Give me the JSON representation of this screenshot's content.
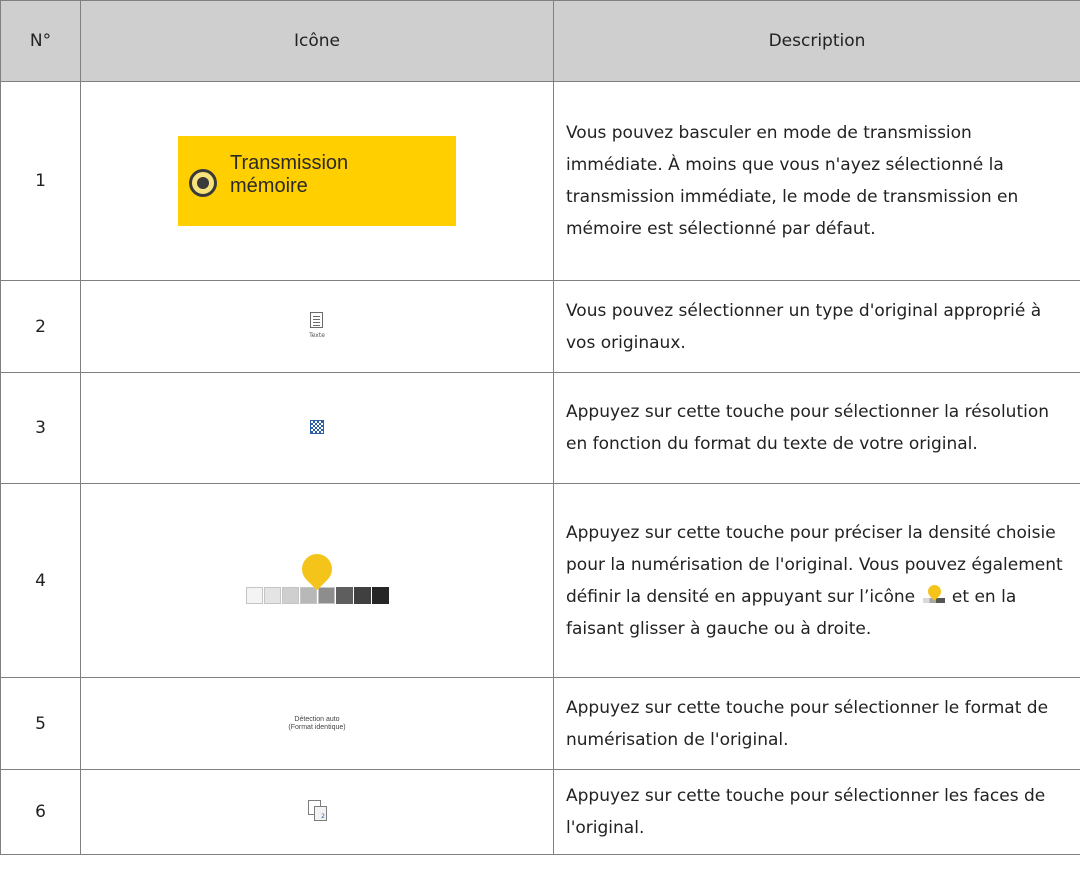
{
  "header": {
    "col_num": "N°",
    "col_icon": "Icône",
    "col_desc": "Description"
  },
  "rows": [
    {
      "num": "1",
      "icon_name": "memory-transmission-radio-icon",
      "icon_label_line1": "Transmission",
      "icon_label_line2": "mémoire",
      "desc": "Vous pouvez basculer en mode de transmission immédiate. À moins que vous n'ayez sélectionné la transmission immédiate, le mode de transmission en mémoire est sélectionné par défaut."
    },
    {
      "num": "2",
      "icon_name": "document-text-icon",
      "icon_caption": "Texte",
      "desc": "Vous pouvez sélectionner un type d'original approprié à vos originaux."
    },
    {
      "num": "3",
      "icon_name": "resolution-icon",
      "desc": "Appuyez sur cette touche pour sélectionner la résolution en fonction du format du texte de votre original."
    },
    {
      "num": "4",
      "icon_name": "density-slider-icon",
      "desc_part1": "Appuyez sur cette touche pour préciser la densité choisie pour la numérisation de l'original. Vous pouvez également définir la densité en appuyant sur l’icône ",
      "desc_part2": " et en la faisant glisser à gauche ou à droite."
    },
    {
      "num": "5",
      "icon_name": "auto-detect-size-icon",
      "icon_label_line1": "Détection auto",
      "icon_label_line2": "(Format identique)",
      "desc": "Appuyez sur cette touche pour sélectionner le format de numérisation de l'original."
    },
    {
      "num": "6",
      "icon_name": "original-faces-icon",
      "icon_badge": "2",
      "desc": "Appuyez sur cette touche pour sélectionner les faces de l'original."
    }
  ],
  "colors": {
    "header_bg": "#cfcfcf",
    "border": "#808080",
    "memory_button_bg": "#ffcf00",
    "density_pin": "#f4c41a"
  }
}
